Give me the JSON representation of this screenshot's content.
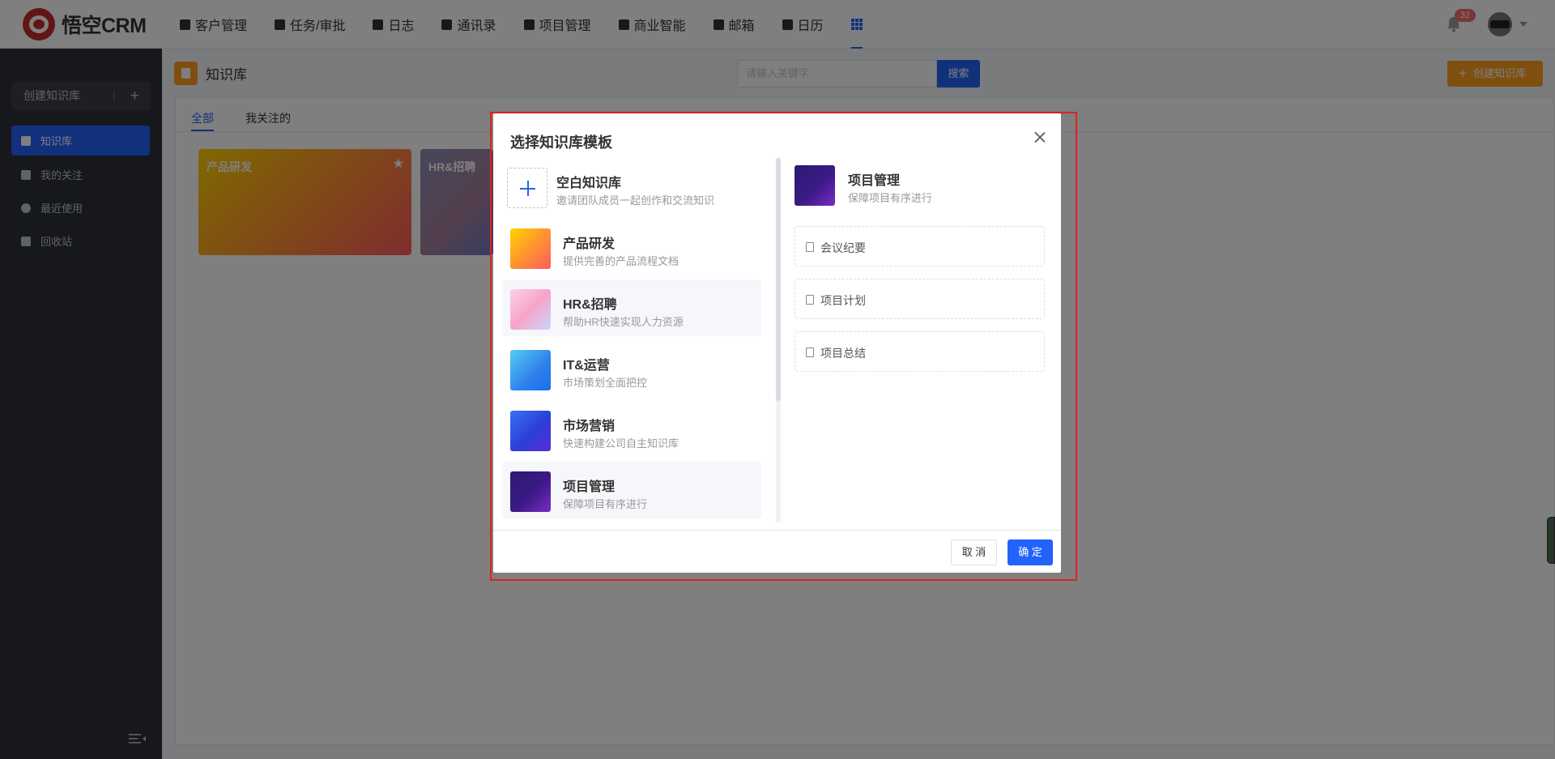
{
  "app": {
    "logo_text": "悟空CRM"
  },
  "nav": {
    "items": [
      {
        "label": "客户管理",
        "icon": "building-icon"
      },
      {
        "label": "任务/审批",
        "icon": "briefcase-icon"
      },
      {
        "label": "日志",
        "icon": "notebook-icon"
      },
      {
        "label": "通讯录",
        "icon": "phone-book-icon"
      },
      {
        "label": "项目管理",
        "icon": "list-icon"
      },
      {
        "label": "商业智能",
        "icon": "shield-icon"
      },
      {
        "label": "邮箱",
        "icon": "mail-icon"
      },
      {
        "label": "日历",
        "icon": "calendar-icon"
      }
    ],
    "apps_icon": "grid-icon",
    "notification_count": "32"
  },
  "sidebar": {
    "create_label": "创建知识库",
    "items": [
      {
        "label": "知识库",
        "icon": "book-icon",
        "active": true
      },
      {
        "label": "我的关注",
        "icon": "star-icon",
        "active": false
      },
      {
        "label": "最近使用",
        "icon": "clock-icon",
        "active": false
      },
      {
        "label": "回收站",
        "icon": "trash-icon",
        "active": false
      }
    ]
  },
  "main": {
    "title": "知识库",
    "search_placeholder": "请输入关键字",
    "search_button": "搜索",
    "create_button": "创建知识库",
    "tabs": [
      {
        "label": "全部",
        "active": true
      },
      {
        "label": "我关注的",
        "active": false
      }
    ],
    "cards": [
      {
        "title": "产品研发"
      },
      {
        "title": "HR&招聘"
      }
    ]
  },
  "dialog": {
    "title": "选择知识库模板",
    "templates": [
      {
        "name": "空白知识库",
        "desc": "邀请团队成员一起创作和交流知识"
      },
      {
        "name": "产品研发",
        "desc": "提供完善的产品流程文档"
      },
      {
        "name": "HR&招聘",
        "desc": "帮助HR快速实现人力资源"
      },
      {
        "name": "IT&运营",
        "desc": "市场策划全面把控"
      },
      {
        "name": "市场营销",
        "desc": "快速构建公司自主知识库"
      },
      {
        "name": "项目管理",
        "desc": "保障项目有序进行"
      }
    ],
    "preview": {
      "name": "项目管理",
      "desc": "保障项目有序进行",
      "docs": [
        "会议纪要",
        "项目计划",
        "项目总结"
      ]
    },
    "cancel": "取 消",
    "confirm": "确 定"
  }
}
